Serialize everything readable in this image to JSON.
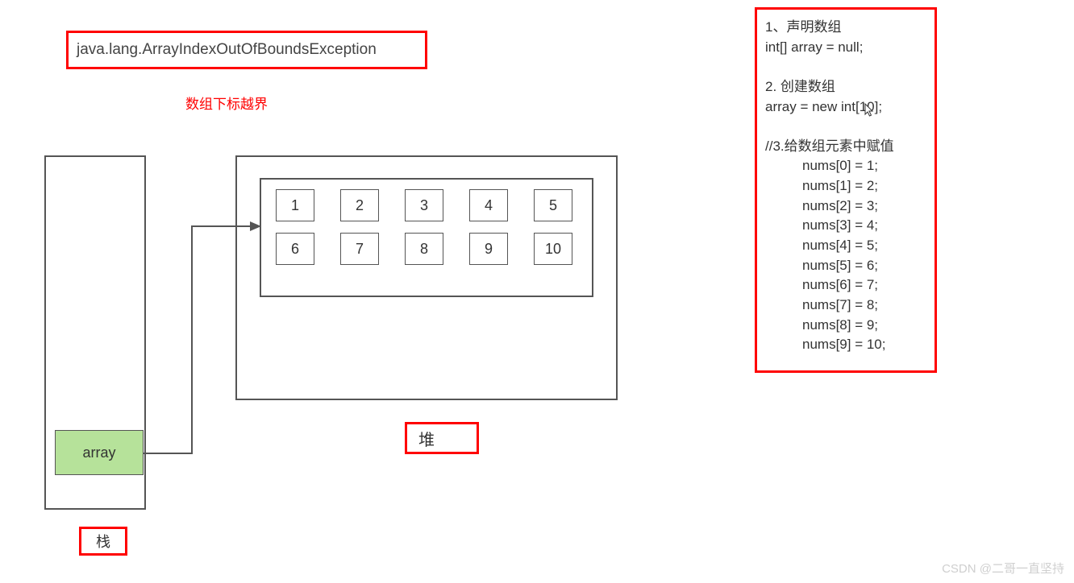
{
  "exception": "java.lang.ArrayIndexOutOfBoundsException",
  "subtitle": "数组下标越界",
  "stack": {
    "var_label": "array",
    "label": "栈"
  },
  "heap": {
    "label": "堆",
    "cells_row1": [
      "1",
      "2",
      "3",
      "4",
      "5"
    ],
    "cells_row2": [
      "6",
      "7",
      "8",
      "9",
      "10"
    ]
  },
  "code": {
    "l1": "1、声明数组",
    "l2": "int[] array = null;",
    "l3": "",
    "l4": "2. 创建数组",
    "l5": "array = new int[10];",
    "l6": "",
    "l7": "//3.给数组元素中赋值",
    "a0": "nums[0] = 1;",
    "a1": "nums[1] = 2;",
    "a2": "nums[2] = 3;",
    "a3": "nums[3] = 4;",
    "a4": "nums[4] = 5;",
    "a5": "nums[5] = 6;",
    "a6": "nums[6] = 7;",
    "a7": "nums[7] = 8;",
    "a8": "nums[8] = 9;",
    "a9": "nums[9] = 10;"
  },
  "watermark": "CSDN @二哥一直坚持"
}
